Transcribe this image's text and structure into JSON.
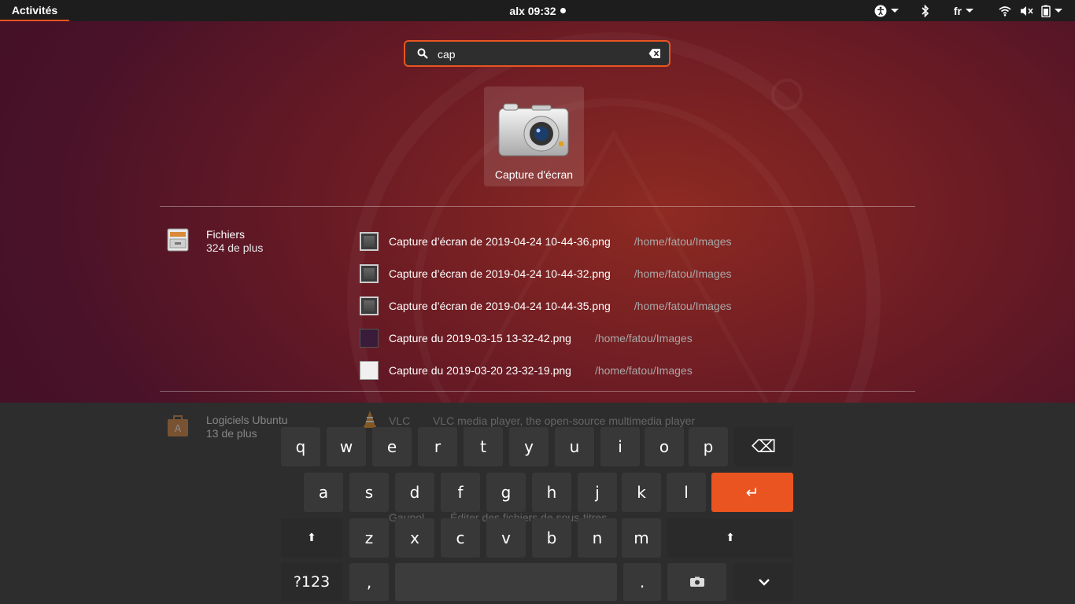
{
  "topbar": {
    "activities": "Activités",
    "clock": "alx 09:32",
    "language": "fr",
    "icons": [
      "accessibility-icon",
      "bluetooth-icon",
      "wifi-icon",
      "volume-muted-icon",
      "battery-icon"
    ]
  },
  "search": {
    "value": "cap",
    "icon": "search-icon",
    "clear_icon": "clear-icon"
  },
  "app_result": {
    "name": "Capture d'écran",
    "icon": "camera-icon"
  },
  "files_provider": {
    "name": "Fichiers",
    "more": "324 de plus",
    "icon": "file-cabinet-icon"
  },
  "file_results": [
    {
      "name": "Capture d’écran de 2019-04-24 10-44-36.png",
      "path": "/home/fatou/Images"
    },
    {
      "name": "Capture d’écran de 2019-04-24 10-44-32.png",
      "path": "/home/fatou/Images"
    },
    {
      "name": "Capture d’écran de 2019-04-24 10-44-35.png",
      "path": "/home/fatou/Images"
    },
    {
      "name": "Capture du 2019-03-15 13-32-42.png",
      "path": "/home/fatou/Images"
    },
    {
      "name": "Capture du 2019-03-20 23-32-19.png",
      "path": "/home/fatou/Images"
    }
  ],
  "software_provider": {
    "name": "Logiciels Ubuntu",
    "more": "13 de plus",
    "icon": "software-bag-icon"
  },
  "software_results": [
    {
      "name": "VLC",
      "desc": "VLC media player, the open-source multimedia player"
    },
    {
      "name": "Gaupol",
      "desc": "Éditer des fichiers de sous-titres"
    }
  ],
  "keyboard": {
    "row1": [
      "q",
      "w",
      "e",
      "r",
      "t",
      "y",
      "u",
      "i",
      "o",
      "p"
    ],
    "row2": [
      "a",
      "s",
      "d",
      "f",
      "g",
      "h",
      "j",
      "k",
      "l"
    ],
    "row3": [
      "z",
      "x",
      "c",
      "v",
      "b",
      "n",
      "m"
    ],
    "backspace": "⌫",
    "enter": "↵",
    "shift": "⬆",
    "numbers": "?123",
    "comma": ",",
    "period": ".",
    "hide": "⌄",
    "emoji_icon": "emoji-icon",
    "accent_color": "#e95420"
  }
}
